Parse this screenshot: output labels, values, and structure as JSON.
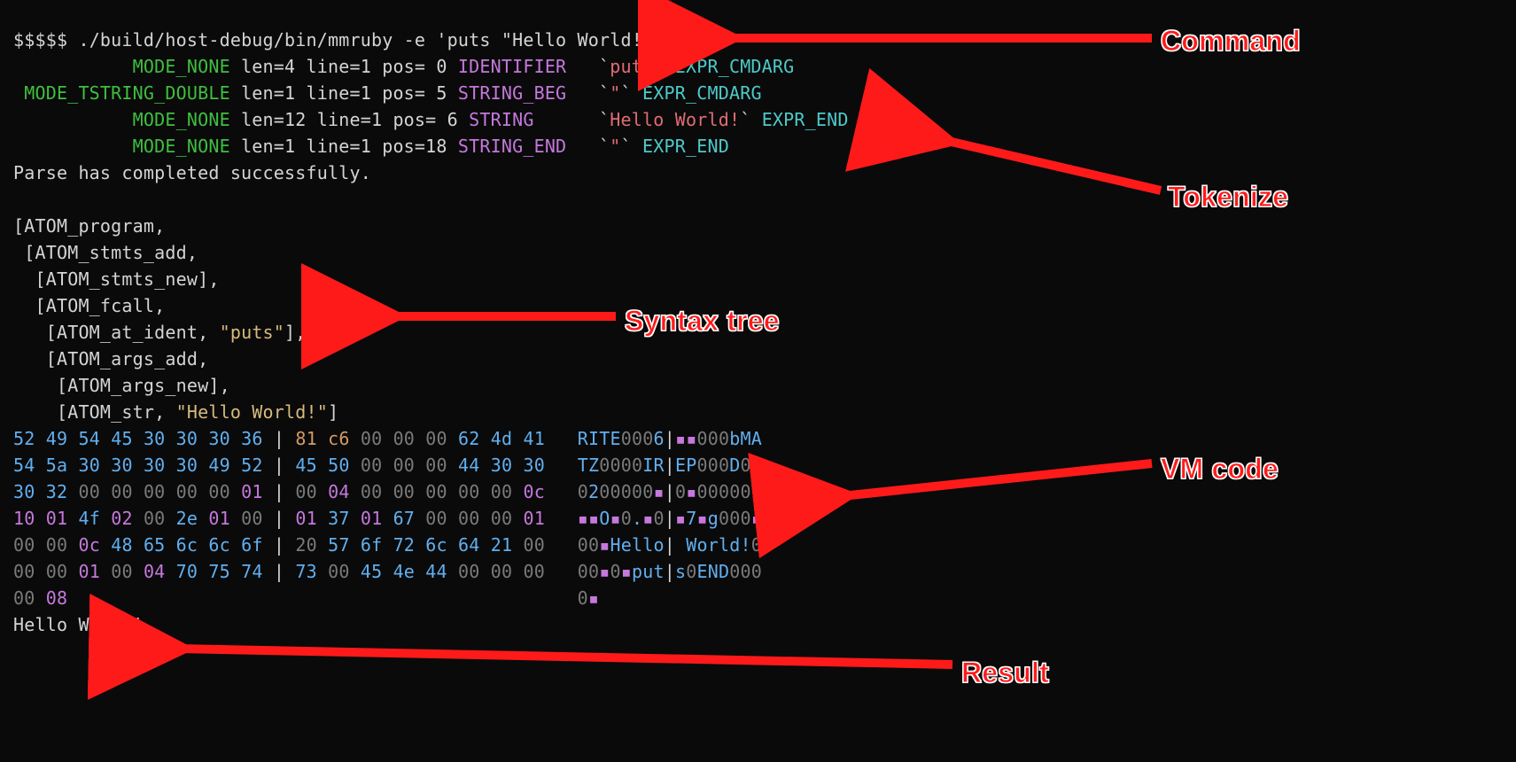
{
  "labels": {
    "command": "Command",
    "tokenize": "Tokenize",
    "syntax_tree": "Syntax tree",
    "vm_code": "VM code",
    "result": "Result"
  },
  "command": {
    "prompt": "$$$$$ ",
    "text": "./build/host-debug/bin/mmruby -e 'puts \"Hello World!\"'"
  },
  "tokens": [
    {
      "mode": "           MODE_NONE",
      "rest": " len=4 line=1 pos= 0 ",
      "type": "IDENTIFIER",
      "pad": "   ",
      "tick_l": "`",
      "value": "puts",
      "tick_r": "` ",
      "expr": "EXPR_CMDARG"
    },
    {
      "mode": " MODE_TSTRING_DOUBLE",
      "rest": " len=1 line=1 pos= 5 ",
      "type": "STRING_BEG",
      "pad": "   ",
      "tick_l": "`",
      "value": "\"",
      "tick_r": "` ",
      "expr": "EXPR_CMDARG"
    },
    {
      "mode": "           MODE_NONE",
      "rest": " len=12 line=1 pos= 6 ",
      "type": "STRING",
      "pad": "      ",
      "tick_l": "`",
      "value": "Hello World!",
      "tick_r": "` ",
      "expr": "EXPR_END"
    },
    {
      "mode": "           MODE_NONE",
      "rest": " len=1 line=1 pos=18 ",
      "type": "STRING_END",
      "pad": "   ",
      "tick_l": "`",
      "value": "\"",
      "tick_r": "` ",
      "expr": "EXPR_END"
    }
  ],
  "parse_msg": "Parse has completed successfully.",
  "syntax_tree": [
    {
      "indent": "",
      "text": "[ATOM_program,"
    },
    {
      "indent": " ",
      "text": "[ATOM_stmts_add,"
    },
    {
      "indent": "  ",
      "text": "[ATOM_stmts_new],"
    },
    {
      "indent": "  ",
      "text": "[ATOM_fcall,"
    },
    {
      "indent": "   ",
      "text": "[ATOM_at_ident, ",
      "str": "\"puts\"",
      "after": "],"
    },
    {
      "indent": "   ",
      "text": "[ATOM_args_add,"
    },
    {
      "indent": "    ",
      "text": "[ATOM_args_new],"
    },
    {
      "indent": "    ",
      "text": "[ATOM_str, ",
      "str": "\"Hello World!\"",
      "after": "]"
    }
  ],
  "hex_colors": {
    "52": "blue",
    "49": "blue",
    "54": "blue",
    "45": "blue",
    "30": "blue",
    "36": "blue",
    "81": "orangebytes",
    "c6": "orangebytes",
    "00": "grey",
    "62": "blue",
    "4d": "blue",
    "41": "blue",
    "5a": "blue",
    "50": "blue",
    "44": "blue",
    "32": "blue",
    "01": "magenta",
    "04": "magenta",
    "0c": "magenta",
    "10": "magenta",
    "4f": "blue",
    "02": "magenta",
    "2e": "blue",
    "37": "blue",
    "67": "blue",
    "48": "blue",
    "65": "blue",
    "6c": "blue",
    "6f": "blue",
    "20": "grey",
    "57": "blue",
    "72": "blue",
    "64": "blue",
    "21": "blue",
    "70": "blue",
    "75": "blue",
    "74": "blue",
    "73": "blue",
    "4e": "blue",
    "08": "magenta"
  },
  "hexdump": [
    {
      "l": [
        "52",
        "49",
        "54",
        "45",
        "30",
        "30",
        "30",
        "36"
      ],
      "r": [
        "81",
        "c6",
        "00",
        "00",
        "00",
        "62",
        "4d",
        "41"
      ],
      "a": "RITE0006|▪▪000bMA"
    },
    {
      "l": [
        "54",
        "5a",
        "30",
        "30",
        "30",
        "30",
        "49",
        "52"
      ],
      "r": [
        "45",
        "50",
        "00",
        "00",
        "00",
        "44",
        "30",
        "30"
      ],
      "a": "TZ0000IR|EP000D00"
    },
    {
      "l": [
        "30",
        "32",
        "00",
        "00",
        "00",
        "00",
        "00",
        "01"
      ],
      "r": [
        "00",
        "04",
        "00",
        "00",
        "00",
        "00",
        "00",
        "0c"
      ],
      "a": "0200000▪|0▪00000▪"
    },
    {
      "l": [
        "10",
        "01",
        "4f",
        "02",
        "00",
        "2e",
        "01",
        "00"
      ],
      "r": [
        "01",
        "37",
        "01",
        "67",
        "00",
        "00",
        "00",
        "01"
      ],
      "a": "▪▪O▪0.▪0|▪7▪g000▪"
    },
    {
      "l": [
        "00",
        "00",
        "0c",
        "48",
        "65",
        "6c",
        "6c",
        "6f"
      ],
      "r": [
        "20",
        "57",
        "6f",
        "72",
        "6c",
        "64",
        "21",
        "00"
      ],
      "a": "00▪Hello| World!0"
    },
    {
      "l": [
        "00",
        "00",
        "01",
        "00",
        "04",
        "70",
        "75",
        "74"
      ],
      "r": [
        "73",
        "00",
        "45",
        "4e",
        "44",
        "00",
        "00",
        "00"
      ],
      "a": "00▪0▪put|s0END000"
    },
    {
      "l": [
        "00",
        "08"
      ],
      "r": [],
      "a": "0▪"
    }
  ],
  "result": "Hello World!"
}
